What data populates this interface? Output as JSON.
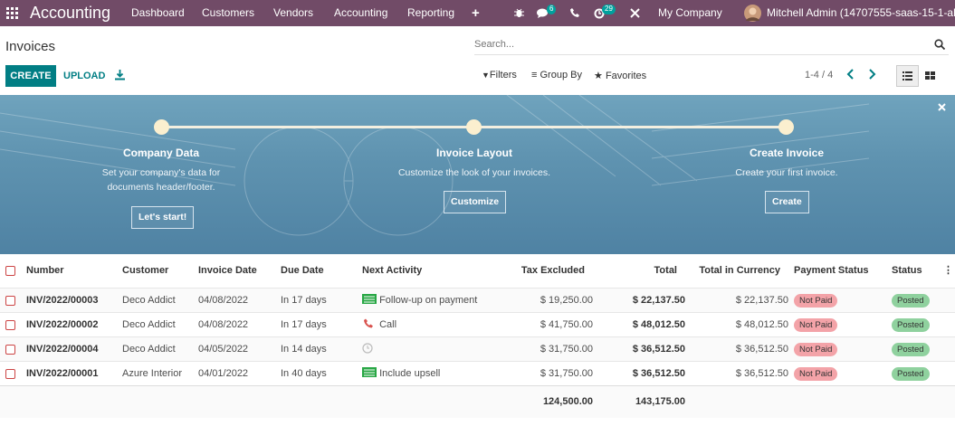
{
  "navbar": {
    "brand": "Accounting",
    "menu": [
      "Dashboard",
      "Customers",
      "Vendors",
      "Accounting",
      "Reporting"
    ],
    "messages_count": "6",
    "activities_count": "29",
    "company": "My Company",
    "user": "Mitchell Admin (14707555-saas-15-1-all)"
  },
  "control": {
    "title": "Invoices",
    "search_placeholder": "Search...",
    "create_label": "CREATE",
    "upload_label": "UPLOAD",
    "filters_label": "Filters",
    "groupby_label": "Group By",
    "favorites_label": "Favorites",
    "pager": "1-4 / 4"
  },
  "onboarding": {
    "steps": [
      {
        "title": "Company Data",
        "desc_line1": "Set your company's data for",
        "desc_line2": "documents header/footer.",
        "button": "Let's start!"
      },
      {
        "title": "Invoice Layout",
        "desc_line1": "Customize the look of your invoices.",
        "desc_line2": "",
        "button": "Customize"
      },
      {
        "title": "Create Invoice",
        "desc_line1": "Create your first invoice.",
        "desc_line2": "",
        "button": "Create"
      }
    ]
  },
  "table": {
    "headers": {
      "number": "Number",
      "customer": "Customer",
      "invoice_date": "Invoice Date",
      "due_date": "Due Date",
      "next_activity": "Next Activity",
      "tax_excluded": "Tax Excluded",
      "total": "Total",
      "total_currency": "Total in Currency",
      "payment_status": "Payment Status",
      "status": "Status"
    },
    "rows": [
      {
        "number": "INV/2022/00003",
        "customer": "Deco Addict",
        "invoice_date": "04/08/2022",
        "due_date": "In 17 days",
        "activity": "Follow-up on payment",
        "activity_icon": "email-stack-icon",
        "tax_excluded": "$ 19,250.00",
        "total": "$ 22,137.50",
        "total_currency": "$ 22,137.50",
        "payment_status": "Not Paid",
        "status": "Posted"
      },
      {
        "number": "INV/2022/00002",
        "customer": "Deco Addict",
        "invoice_date": "04/08/2022",
        "due_date": "In 17 days",
        "activity": "Call",
        "activity_icon": "phone-icon",
        "tax_excluded": "$ 41,750.00",
        "total": "$ 48,012.50",
        "total_currency": "$ 48,012.50",
        "payment_status": "Not Paid",
        "status": "Posted"
      },
      {
        "number": "INV/2022/00004",
        "customer": "Deco Addict",
        "invoice_date": "04/05/2022",
        "due_date": "In 14 days",
        "activity": "",
        "activity_icon": "clock-icon",
        "tax_excluded": "$ 31,750.00",
        "total": "$ 36,512.50",
        "total_currency": "$ 36,512.50",
        "payment_status": "Not Paid",
        "status": "Posted"
      },
      {
        "number": "INV/2022/00001",
        "customer": "Azure Interior",
        "invoice_date": "04/01/2022",
        "due_date": "In 40 days",
        "activity": "Include upsell",
        "activity_icon": "email-stack-icon",
        "tax_excluded": "$ 31,750.00",
        "total": "$ 36,512.50",
        "total_currency": "$ 36,512.50",
        "payment_status": "Not Paid",
        "status": "Posted"
      }
    ],
    "totals": {
      "tax_excluded": "124,500.00",
      "total": "143,175.00"
    }
  },
  "colors": {
    "navbar": "#714b67",
    "primary": "#017e84",
    "not_paid": "#f3a3a8",
    "posted": "#8fd19e"
  }
}
